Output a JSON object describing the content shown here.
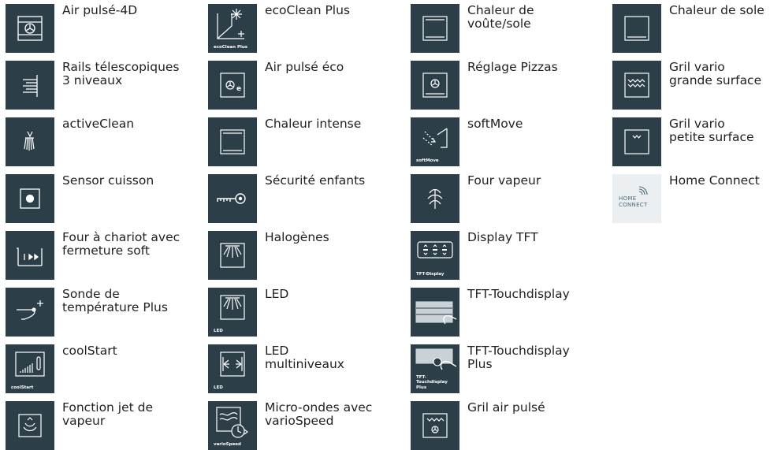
{
  "columns": [
    {
      "items": [
        {
          "label": "Air pulsé-4D",
          "icon": "hot-air-4d-icon",
          "caption": ""
        },
        {
          "label": "Rails télescopiques\n3 niveaux",
          "icon": "telescopic-rails-icon",
          "caption": ""
        },
        {
          "label": "activeClean",
          "icon": "active-clean-icon",
          "caption": ""
        },
        {
          "label": "Sensor cuisson",
          "icon": "cooking-sensor-icon",
          "caption": ""
        },
        {
          "label": "Four à chariot avec\nfermeture soft",
          "icon": "trolley-oven-icon",
          "caption": ""
        },
        {
          "label": "Sonde de\ntempérature Plus",
          "icon": "temperature-probe-icon",
          "caption": ""
        },
        {
          "label": "coolStart",
          "icon": "cool-start-icon",
          "caption": "coolStart"
        },
        {
          "label": "Fonction jet de\nvapeur",
          "icon": "steam-jet-icon",
          "caption": ""
        }
      ]
    },
    {
      "items": [
        {
          "label": "ecoClean Plus",
          "icon": "eco-clean-icon",
          "caption": "ecoClean Plus"
        },
        {
          "label": "Air pulsé éco",
          "icon": "eco-hot-air-icon",
          "caption": ""
        },
        {
          "label": "Chaleur intense",
          "icon": "intensive-heat-icon",
          "caption": ""
        },
        {
          "label": "Sécurité enfants",
          "icon": "child-lock-key-icon",
          "caption": ""
        },
        {
          "label": "Halogènes",
          "icon": "halogen-light-icon",
          "caption": ""
        },
        {
          "label": "LED",
          "icon": "led-light-icon",
          "caption": "LED"
        },
        {
          "label": "LED\nmultiniveaux",
          "icon": "led-multilevel-icon",
          "caption": "LED"
        },
        {
          "label": "Micro-ondes avec\nvarioSpeed",
          "icon": "microwave-variospeed-icon",
          "caption": "varioSpeed"
        }
      ]
    },
    {
      "items": [
        {
          "label": "Chaleur de\nvoûte/sole",
          "icon": "top-bottom-heat-icon",
          "caption": ""
        },
        {
          "label": "Réglage Pizzas",
          "icon": "pizza-setting-icon",
          "caption": ""
        },
        {
          "label": "softMove",
          "icon": "soft-move-icon",
          "caption": "softMove"
        },
        {
          "label": "Four vapeur",
          "icon": "steam-oven-icon",
          "caption": ""
        },
        {
          "label": "Display TFT",
          "icon": "tft-display-icon",
          "caption": "TFT-Display"
        },
        {
          "label": "TFT-Touchdisplay",
          "icon": "tft-touchdisplay-icon",
          "caption": ""
        },
        {
          "label": "TFT-Touchdisplay\nPlus",
          "icon": "tft-touchdisplay-plus-icon",
          "caption": "TFT-\nTouchdisplay\nPlus"
        },
        {
          "label": "Gril air pulsé",
          "icon": "grill-hot-air-icon",
          "caption": ""
        }
      ]
    },
    {
      "items": [
        {
          "label": "Chaleur de sole",
          "icon": "bottom-heat-icon",
          "caption": ""
        },
        {
          "label": "Gril vario\ngrande surface",
          "icon": "full-surface-grill-icon",
          "caption": ""
        },
        {
          "label": "Gril vario\npetite surface",
          "icon": "small-surface-grill-icon",
          "caption": ""
        },
        {
          "label": "Home Connect",
          "icon": "home-connect-logo-icon",
          "caption": "",
          "logo_text": "HOME\nCONNECT"
        }
      ]
    }
  ],
  "colors": {
    "tile": "#2c3f49",
    "icon_line": "#ffffff",
    "logo_tile": "#eceff1",
    "label_text": "#1f1f1f"
  }
}
